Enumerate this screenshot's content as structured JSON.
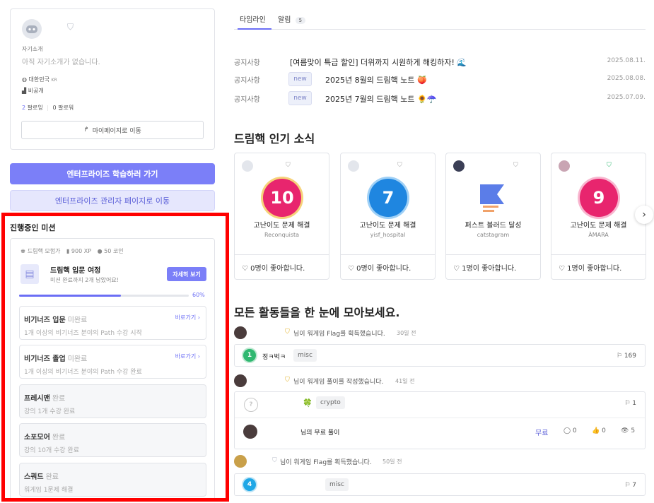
{
  "profile": {
    "intro_label": "자기소개",
    "intro_text": "아직 자기소개가 없습니다.",
    "country": "대한민국",
    "country_code": "KR",
    "company": "비공개",
    "following_count": "2",
    "following_label": "팔로잉",
    "follower_count": "0",
    "follower_label": "팔로워",
    "mypage_button": "마이페이지로 이동"
  },
  "enterprise": {
    "learn_button": "엔터프라이즈 학습하러 가기",
    "admin_button": "엔터프라이즈 관리자 페이지로 이동"
  },
  "mission": {
    "section_title": "진행중인 미션",
    "rank": "드림핵 모험가",
    "xp": "900 XP",
    "coins": "50 코인",
    "title": "드림핵 입문 여정",
    "subtitle": "미션 완료까지 2개 남았어요!",
    "detail_button": "자세히 보기",
    "progress_label": "60%",
    "progress_value": 0.6,
    "items": [
      {
        "title": "비기너즈 입문",
        "status": "미완료",
        "desc": "1개 이상의 비기너즈 분야의 Path 수강 시작",
        "go": "바로가기",
        "done": false
      },
      {
        "title": "비기너즈 졸업",
        "status": "미완료",
        "desc": "1개 이상의 비기너즈 분야의 Path 수강 완료",
        "go": "바로가기",
        "done": false
      },
      {
        "title": "프레시맨",
        "status": "완료",
        "desc": "강의 1개 수강 완료",
        "done": true
      },
      {
        "title": "소포모어",
        "status": "완료",
        "desc": "강의 10개 수강 완료",
        "done": true
      },
      {
        "title": "스쿼드",
        "status": "완료",
        "desc": "워게임 1문제 해결",
        "done": true
      }
    ]
  },
  "tabs": {
    "timeline": "타임라인",
    "notifications": "알림",
    "notifications_count": "5"
  },
  "notices": [
    {
      "category": "공지사항",
      "new": "",
      "title": "[여름맞이 특급 할인] 더위까지 시원하게 해킹하자! 🌊",
      "date": "2025.08.11."
    },
    {
      "category": "공지사항",
      "new": "new",
      "title": "2025년 8월의 드림핵 노트 🍑",
      "date": "2025.08.08."
    },
    {
      "category": "공지사항",
      "new": "new",
      "title": "2025년 7월의 드림핵 노트 🌻☂️",
      "date": "2025.07.09."
    }
  ],
  "popular": {
    "title": "드림핵 인기 소식",
    "cards": [
      {
        "number": "10",
        "label": "고난이도 문제 해결",
        "user": "Reconquista",
        "likes": "0명이 좋아합니다.",
        "color": "#e8256e"
      },
      {
        "number": "7",
        "label": "고난이도 문제 해결",
        "user": "yisf_hospital",
        "likes": "0명이 좋아합니다.",
        "color": "#1f86e0"
      },
      {
        "number": "",
        "label": "퍼스트 블러드 달성",
        "user": "catstagram",
        "likes": "1명이 좋아합니다.",
        "color": "#5b7de8"
      },
      {
        "number": "9",
        "label": "고난이도 문제 해결",
        "user": "ÀMARA",
        "likes": "1명이 좋아합니다.",
        "color": "#e8256e"
      }
    ]
  },
  "activity": {
    "title": "모든 활동들을 한 눈에 모아보세요.",
    "items": [
      {
        "text": "님이 워게임 Flag를 획득했습니다.",
        "time": "30일 전",
        "level": "1",
        "level_color": "#2fb870",
        "post_title": "정ㅋ벅ㅋ",
        "tag": "misc",
        "flags": "169"
      },
      {
        "text": "님이 워게임 풀이를 작성했습니다.",
        "time": "41일 전",
        "level": "?",
        "level_color": "#c8c8c8",
        "post_icon": "🍀",
        "tag": "crypto",
        "flags": "1",
        "reply_title": "님의 무료 풀이",
        "price": "무료",
        "comments": "0",
        "likes": "0",
        "views": "5"
      },
      {
        "text": "님이 워게임 Flag를 획득했습니다.",
        "time": "50일 전",
        "level": "4",
        "level_color": "#1fa7e6",
        "tag": "misc",
        "flags": "7"
      }
    ]
  }
}
